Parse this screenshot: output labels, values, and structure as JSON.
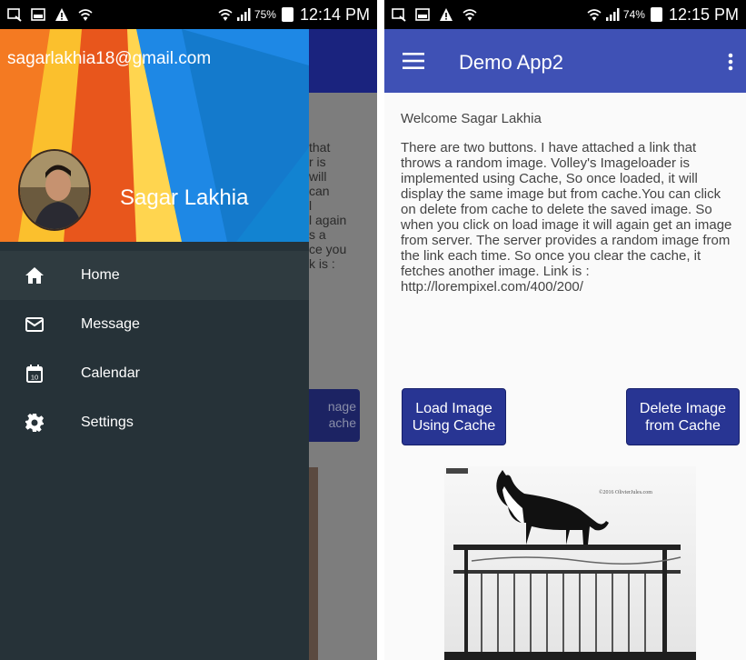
{
  "left_screen": {
    "status_bar": {
      "battery_pct": "75%",
      "time": "12:14 PM"
    },
    "drawer": {
      "email": "sagarlakhia18@gmail.com",
      "username": "Sagar Lakhia",
      "items": [
        {
          "label": "Home",
          "icon": "home-icon",
          "active": true
        },
        {
          "label": "Message",
          "icon": "mail-icon",
          "active": false
        },
        {
          "label": "Calendar",
          "icon": "calendar-icon",
          "active": false
        },
        {
          "label": "Settings",
          "icon": "gear-icon",
          "active": false
        }
      ],
      "calendar_icon_day": "10"
    },
    "background": {
      "text_fragment": "that\nr is\nwill\ncan\nl\nl again\ns a\nce you\nk is :",
      "button_fragment": "nage\nache"
    }
  },
  "right_screen": {
    "status_bar": {
      "battery_pct": "74%",
      "time": "12:15 PM"
    },
    "toolbar": {
      "title": "Demo App2"
    },
    "welcome": "Welcome Sagar Lakhia",
    "description": "There are two buttons. I have attached a link that throws a random image. Volley's Imageloader is implemented using Cache, So once loaded, it will display the same image but from cache.You can click on delete from cache to delete the saved image. So when you click on load image it will again get an image from server. The server provides a random image from the link each time. So once you clear the cache, it fetches another image. Link is : http://lorempixel.com/400/200/",
    "buttons": {
      "load": "Load Image Using Cache",
      "delete": "Delete Image from Cache"
    },
    "image": {
      "copyright": "©2016 OlivierJules.com"
    }
  },
  "colors": {
    "primary": "#3f51b5",
    "primary_dark": "#283593",
    "drawer_bg": "#263238",
    "status_bar": "#000000"
  }
}
